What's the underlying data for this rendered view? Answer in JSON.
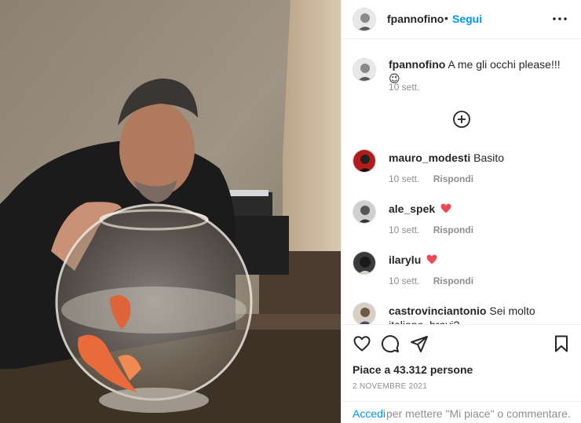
{
  "post": {
    "author": "fpannofino",
    "follow_label": "Segui",
    "dot": "•",
    "caption_user": "fpannofino",
    "caption_text": "A me gli occhi please!!!",
    "caption_emoji": "😉",
    "caption_time": "10 sett.",
    "likes_label": "Piace a 43.312 persone",
    "date_label": "2 NOVEMBRE 2021"
  },
  "comments": [
    {
      "user": "mauro_modesti",
      "text": "Basito",
      "time": "10 sett.",
      "reply": "Rispondi",
      "emoji": ""
    },
    {
      "user": "ale_spek",
      "text": "",
      "time": "10 sett.",
      "reply": "Rispondi",
      "emoji": "red-heart"
    },
    {
      "user": "ilarylu",
      "text": "",
      "time": "10 sett.",
      "reply": "Rispondi",
      "emoji": "red-heart"
    },
    {
      "user": "castrovinciantonio",
      "text": "Sei molto italiano, bravi?",
      "time": "",
      "reply": "",
      "emoji": ""
    }
  ],
  "login": {
    "link": "Accedi",
    "rest": "per mettere \"Mi piace\" o commentare."
  },
  "icons": {
    "more": "more-horizontal-icon",
    "load_more": "plus-circle-icon",
    "like": "heart-outline-icon",
    "comment": "comment-bubble-icon",
    "share": "paper-plane-icon",
    "save": "bookmark-icon"
  },
  "colors": {
    "link_blue": "#0095f6",
    "text_primary": "#262626",
    "text_secondary": "#8e8e8e",
    "heart_red": "#ed4956"
  }
}
